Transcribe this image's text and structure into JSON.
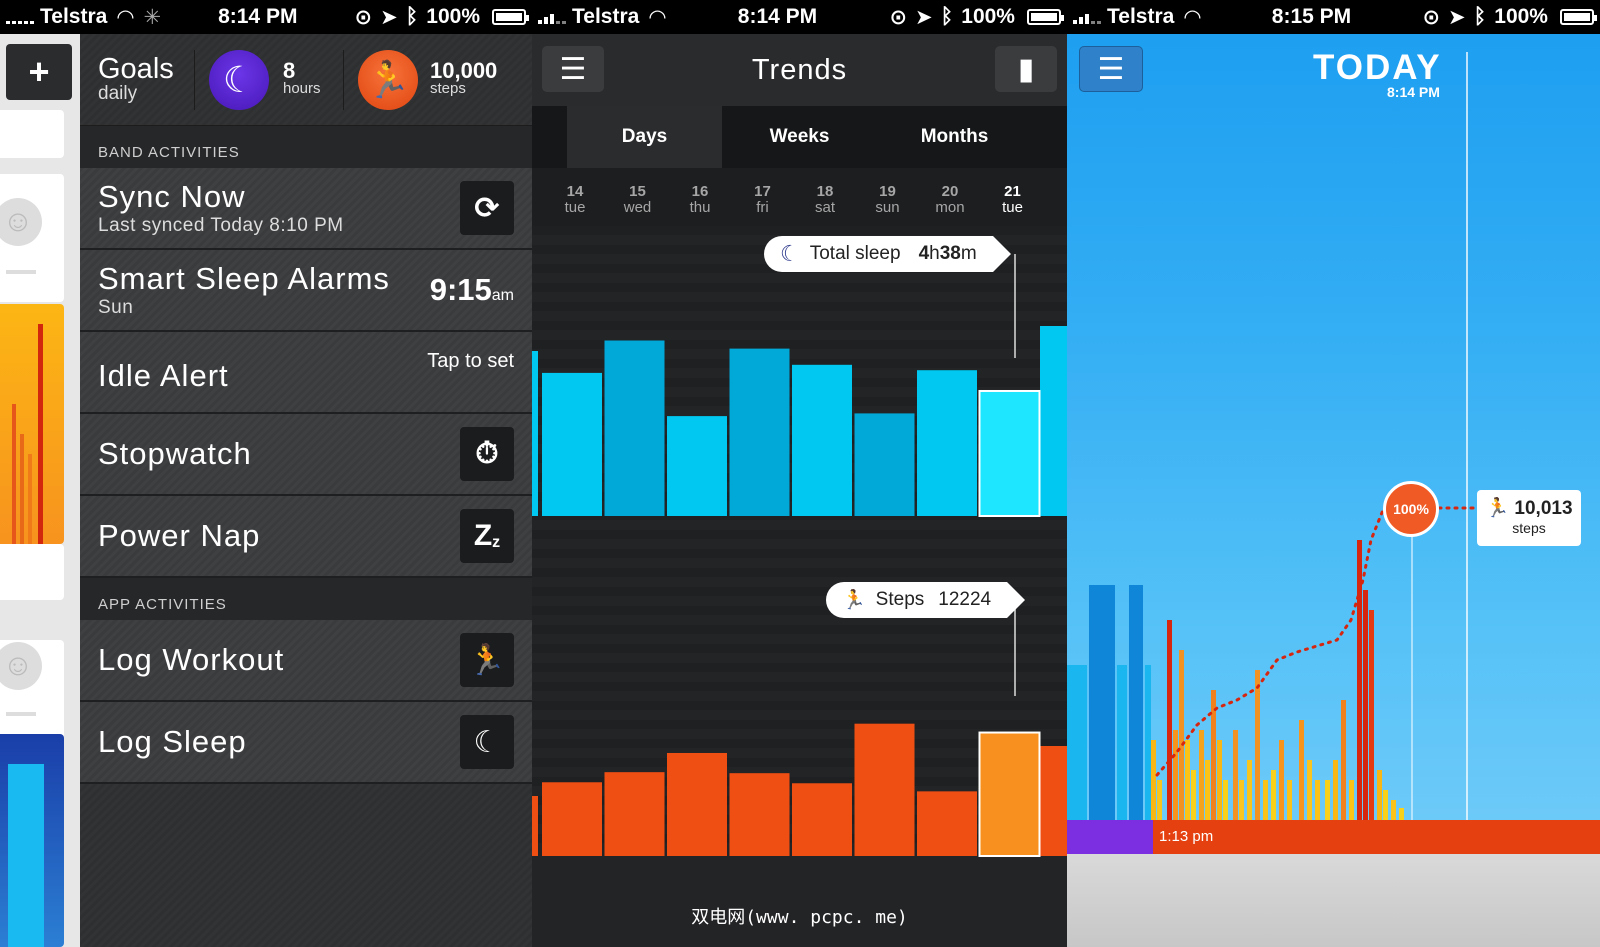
{
  "status_bars": [
    {
      "carrier": "Telstra",
      "time": "8:14 PM",
      "battery": "100%"
    },
    {
      "carrier": "Telstra",
      "time": "8:14 PM",
      "battery": "100%"
    },
    {
      "carrier": "Telstra",
      "time": "8:15 PM",
      "battery": "100%"
    }
  ],
  "left_menu": {
    "add_label": "+",
    "goals": {
      "title": "Goals",
      "subtitle": "daily",
      "sleep_value": "8",
      "sleep_unit": "hours",
      "steps_value": "10,000",
      "steps_unit": "steps"
    },
    "band_header": "BAND ACTIVITIES",
    "sync": {
      "title": "Sync Now",
      "subtitle": "Last synced Today 8:10 PM"
    },
    "alarm": {
      "title": "Smart Sleep Alarms",
      "subtitle": "Sun",
      "time": "9:15",
      "ampm": "am"
    },
    "idle": {
      "title": "Idle Alert",
      "action": "Tap to set"
    },
    "stopwatch": {
      "title": "Stopwatch"
    },
    "powernap": {
      "title": "Power Nap",
      "icon_text": "Z",
      "icon_sub": "z"
    },
    "app_header": "APP ACTIVITIES",
    "workout": {
      "title": "Log Workout"
    },
    "sleep": {
      "title": "Log Sleep"
    }
  },
  "trends": {
    "title": "Trends",
    "tabs": [
      "Days",
      "Weeks",
      "Months"
    ],
    "active_tab": "Days",
    "days": [
      {
        "num": "14",
        "wd": "tue"
      },
      {
        "num": "15",
        "wd": "wed"
      },
      {
        "num": "16",
        "wd": "thu"
      },
      {
        "num": "17",
        "wd": "fri"
      },
      {
        "num": "18",
        "wd": "sat"
      },
      {
        "num": "19",
        "wd": "sun"
      },
      {
        "num": "20",
        "wd": "mon"
      },
      {
        "num": "21",
        "wd": "tue"
      }
    ],
    "sleep_label": "Total sleep",
    "sleep_hours": "4",
    "sleep_h": "h",
    "sleep_minutes": "38",
    "sleep_m": "m",
    "steps_label": "Steps",
    "steps_value": "12224",
    "watermark": "双电网(www. pcpc. me)"
  },
  "chart_data": [
    {
      "type": "bar",
      "categories": [
        "14",
        "15",
        "16",
        "17",
        "18",
        "19",
        "20",
        "21"
      ],
      "series": [
        {
          "values": [
            5.3,
            6.5,
            3.7,
            6.2,
            5.6,
            3.8,
            5.4,
            4.63
          ]
        }
      ],
      "selected": "21"
    },
    {
      "type": "bar",
      "categories": [
        "14",
        "15",
        "16",
        "17",
        "18",
        "19",
        "20",
        "21"
      ],
      "series": [
        {
          "values": [
            7300,
            8300,
            10200,
            8200,
            7200,
            13100,
            6400,
            12224
          ]
        }
      ],
      "selected": "21"
    }
  ],
  "today": {
    "title": "TODAY",
    "time": "8:14 PM",
    "percent": "100%",
    "steps_value": "10,013",
    "steps_unit": "steps",
    "band_time": "1:13 pm"
  },
  "colors": {
    "sleep_bar": "#00c8f0",
    "sleep_bar_alt": "#00a9d8",
    "steps_bar": "#f04f14",
    "selected_sleep": "#1ee6ff",
    "selected_steps": "#f7901e",
    "accent_orange": "#f05a24",
    "accent_purple": "#6a2ad9"
  }
}
